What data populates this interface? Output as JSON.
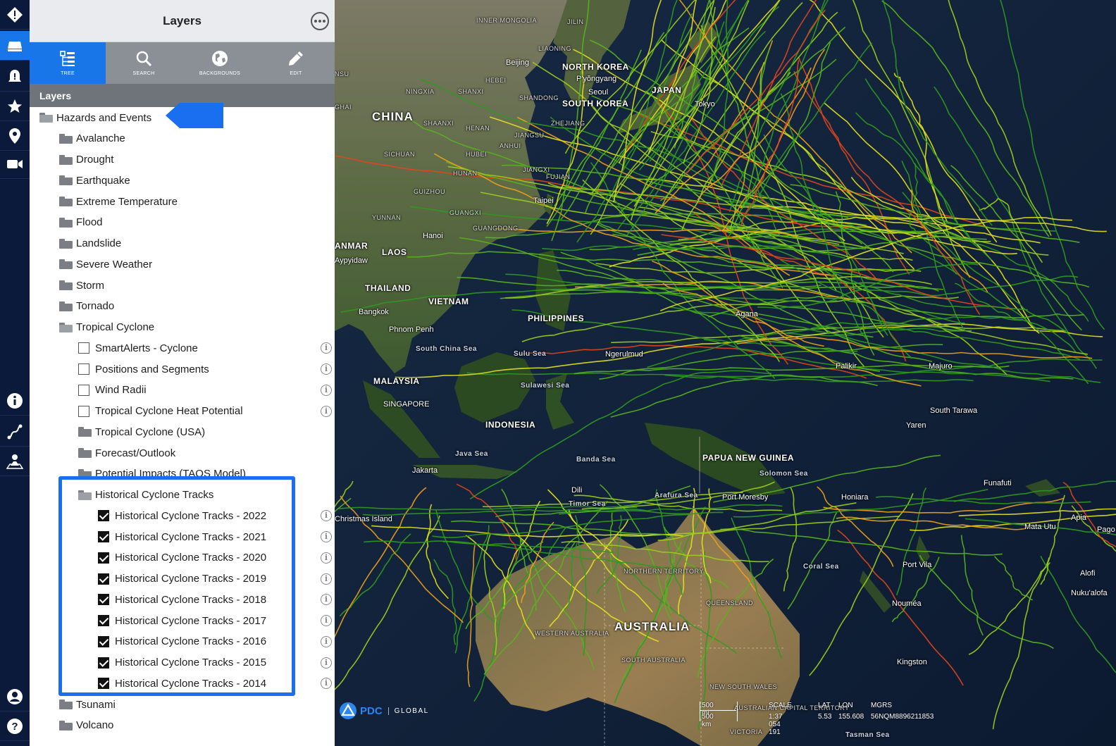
{
  "rail": {
    "items": [
      {
        "name": "alert-diamond-icon"
      },
      {
        "name": "layers-icon",
        "active": true
      },
      {
        "name": "alarm-icon"
      },
      {
        "name": "star-icon"
      },
      {
        "name": "location-pin-icon"
      },
      {
        "name": "video-camera-icon"
      },
      {
        "name": "info-icon"
      },
      {
        "name": "route-icon"
      },
      {
        "name": "map-user-icon"
      },
      {
        "name": "user-icon"
      },
      {
        "name": "help-icon"
      }
    ]
  },
  "panel": {
    "title": "Layers",
    "tabs": [
      {
        "label": "TREE",
        "icon": "tree-icon",
        "active": true
      },
      {
        "label": "SEARCH",
        "icon": "search-icon"
      },
      {
        "label": "BACKGROUNDS",
        "icon": "globe-icon"
      },
      {
        "label": "EDIT",
        "icon": "pencil-icon"
      }
    ],
    "section_label": "Layers",
    "tree": {
      "root": "Hazards and Events",
      "folders_a": [
        "Avalanche",
        "Drought",
        "Earthquake",
        "Extreme Temperature",
        "Flood",
        "Landslide",
        "Severe Weather",
        "Storm",
        "Tornado"
      ],
      "tropical": "Tropical Cyclone",
      "tropical_checks": [
        "SmartAlerts - Cyclone",
        "Positions and Segments",
        "Wind Radii",
        "Tropical Cyclone Heat Potential"
      ],
      "tropical_folders": [
        "Tropical Cyclone (USA)",
        "Forecast/Outlook",
        "Potential Impacts (TAOS Model)"
      ],
      "historical": "Historical Cyclone Tracks",
      "historical_items": [
        "Historical Cyclone Tracks - 2022",
        "Historical Cyclone Tracks - 2021",
        "Historical Cyclone Tracks - 2020",
        "Historical Cyclone Tracks - 2019",
        "Historical Cyclone Tracks - 2018",
        "Historical Cyclone Tracks - 2017",
        "Historical Cyclone Tracks - 2016",
        "Historical Cyclone Tracks - 2015",
        "Historical Cyclone Tracks - 2014"
      ],
      "folders_b": [
        "Tsunami",
        "Volcano"
      ]
    }
  },
  "map": {
    "labels_big": [
      "CHINA",
      "AUSTRALIA"
    ],
    "labels_country": [
      "NORTH KOREA",
      "SOUTH KOREA",
      "JAPAN",
      "THAILAND",
      "MALAYSIA",
      "INDONESIA",
      "PAPUA NEW GUINEA",
      "ANMAR",
      "LAOS",
      "VIETNAM",
      "PHILIPPINES"
    ],
    "labels_city": [
      "Beijing",
      "P'yŏngyang",
      "Seoul",
      "Tokyo",
      "Taipei",
      "Hanoi",
      "Bangkok",
      "Phnom Penh",
      "Jakarta",
      "Dili",
      "Port Moresby",
      "Palikir",
      "Majuro",
      "Yaren",
      "South Tarawa",
      "Funafuti",
      "Apia",
      "Port Vila",
      "Honiara",
      "Kingston",
      "Nouméa",
      "Agana",
      "Ngerulmud",
      "Aypyidaw",
      "Mata Utu",
      "Alofi",
      "Pago",
      "Nuku'alofa",
      "Christmas Island",
      "SINGAPORE"
    ],
    "labels_small": [
      "INNER MONGOLIA",
      "LIAONING",
      "JILIN",
      "HEBEI",
      "SHANDONG",
      "NINGXIA",
      "SHANXI",
      "HENAN",
      "JIANGSU",
      "ANHUI",
      "SHAANXI",
      "SICHUAN",
      "HUBEI",
      "HUNAN",
      "GUIZHOU",
      "YUNNAN",
      "GUANGXI",
      "GUANGDONG",
      "ZHEJIANG",
      "JIANGXI",
      "FUJIAN",
      "NORTHERN TERRITORY",
      "QUEENSLAND",
      "WESTERN AUSTRALIA",
      "SOUTH AUSTRALIA",
      "NEW SOUTH WALES",
      "AUSTRALIAN CAPITAL TERRITORY",
      "VICTORIA",
      "GHAI",
      "NSU"
    ],
    "labels_sea": [
      "South China Sea",
      "Sulu Sea",
      "Sulawesi Sea",
      "Java Sea",
      "Banda Sea",
      "Timor Sea",
      "Arafura Sea",
      "Coral Sea",
      "Solomon Sea",
      "Tasman Sea"
    ],
    "logo": {
      "brand": "PDC",
      "sub": "GLOBAL"
    },
    "scale": {
      "mi": "500 mi",
      "km": "500 km",
      "scale_label": "SCALE",
      "scale_value": "1:37 054 191",
      "lat_label": "LAT",
      "lat_value": "5.53",
      "lon_label": "LON",
      "lon_value": "155.608",
      "mgrs_label": "MGRS",
      "mgrs_value": "56NQM8896211853"
    },
    "track_colors": [
      "#2f9a1f",
      "#56b51d",
      "#9ccf1c",
      "#e4e21e",
      "#f0a21a",
      "#e2461b"
    ]
  }
}
